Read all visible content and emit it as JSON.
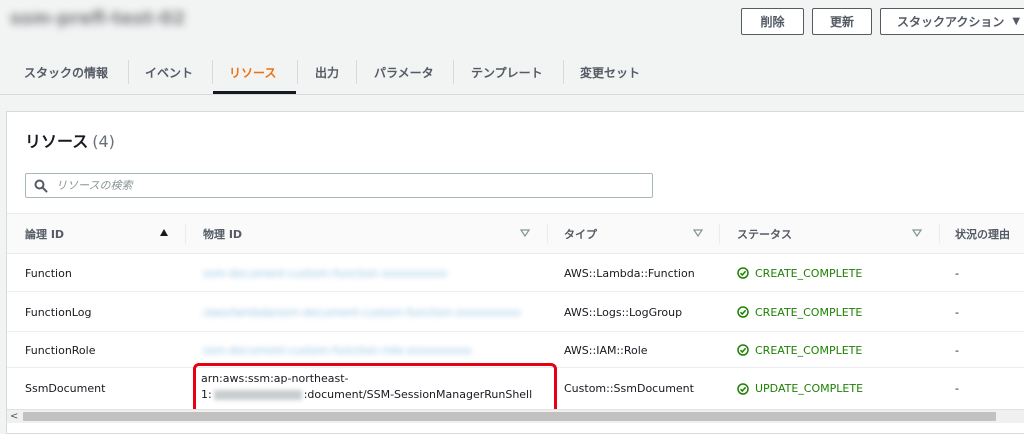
{
  "header": {
    "stack_name": "ssm-prefl-test-02",
    "delete_label": "削除",
    "update_label": "更新",
    "actions_label": "スタックアクション"
  },
  "tabs": [
    {
      "label": "スタックの情報"
    },
    {
      "label": "イベント"
    },
    {
      "label": "リソース",
      "active": true
    },
    {
      "label": "出力"
    },
    {
      "label": "パラメータ"
    },
    {
      "label": "テンプレート"
    },
    {
      "label": "変更セット"
    }
  ],
  "resources": {
    "title": "リソース",
    "count": "(4)",
    "search_placeholder": "リソースの検索",
    "columns": [
      "論理 ID",
      "物理 ID",
      "タイプ",
      "ステータス",
      "状況の理由"
    ],
    "rows": [
      {
        "logical_id": "Function",
        "physical_id": "ssm-document-custom-function-xxxxxxxxxx",
        "type": "AWS::Lambda::Function",
        "status": "CREATE_COMPLETE",
        "reason": "-"
      },
      {
        "logical_id": "FunctionLog",
        "physical_id": "/aws/lambda/ssm-document-custom-function-xxxxxxxxxx",
        "type": "AWS::Logs::LogGroup",
        "status": "CREATE_COMPLETE",
        "reason": "-"
      },
      {
        "logical_id": "FunctionRole",
        "physical_id": "ssm-document-custom-function-role-xxxxxxxxxx",
        "type": "AWS::IAM::Role",
        "status": "CREATE_COMPLETE",
        "reason": "-"
      },
      {
        "logical_id": "SsmDocument",
        "physical_id_line1": "arn:aws:ssm:ap-northeast-",
        "physical_id_line2a": "1:",
        "physical_id_line2b": ":document/SSM-SessionManagerRunShell",
        "type": "Custom::SsmDocument",
        "status": "UPDATE_COMPLETE",
        "reason": "-"
      }
    ]
  },
  "colors": {
    "accent": "#ec7211",
    "success": "#1d8102",
    "highlight": "#e60012"
  },
  "icons": {
    "search": "search-icon",
    "status_ok": "check-circle-icon",
    "sort_asc": "sort-ascending-icon",
    "sort": "sort-icon"
  }
}
